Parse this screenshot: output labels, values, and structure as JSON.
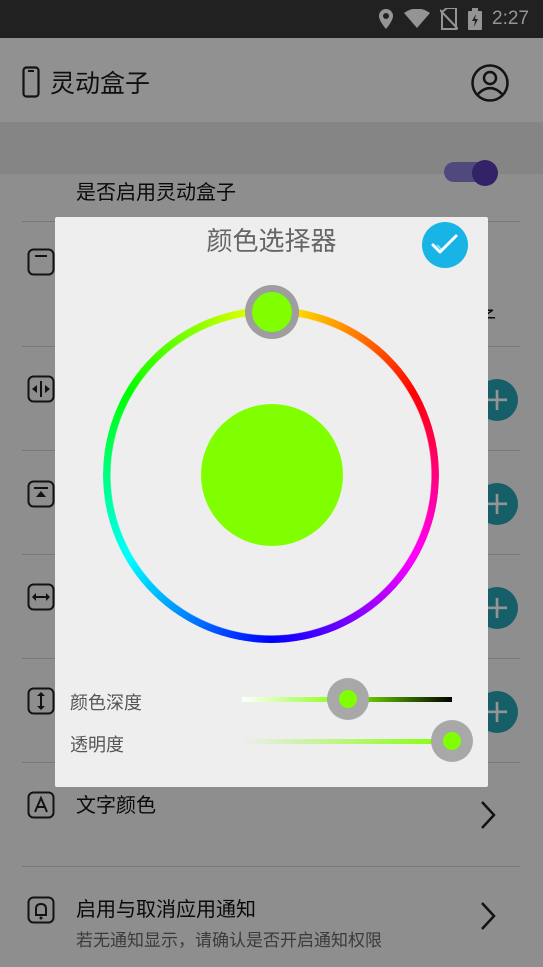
{
  "status_bar": {
    "time": "2:27"
  },
  "app_bar": {
    "title": "灵动盒子"
  },
  "list": {
    "enable_row_title": "是否启用灵动盒子",
    "cut_char": "子",
    "text_color_title": "文字颜色",
    "notify_title": "启用与取消应用通知",
    "notify_subtitle": "若无通知显示，请确认是否开启通知权限",
    "plus_label": "+"
  },
  "dialog": {
    "title": "颜色选择器",
    "selected_color": "#80ff00",
    "depth_label": "颜色深度",
    "depth_value": 0.505,
    "alpha_label": "透明度",
    "alpha_value": 1.0
  },
  "colors": {
    "accent_teal": "#27a2b4",
    "confirm_blue": "#19b4e6",
    "toggle_purple": "#5b3bb5"
  }
}
